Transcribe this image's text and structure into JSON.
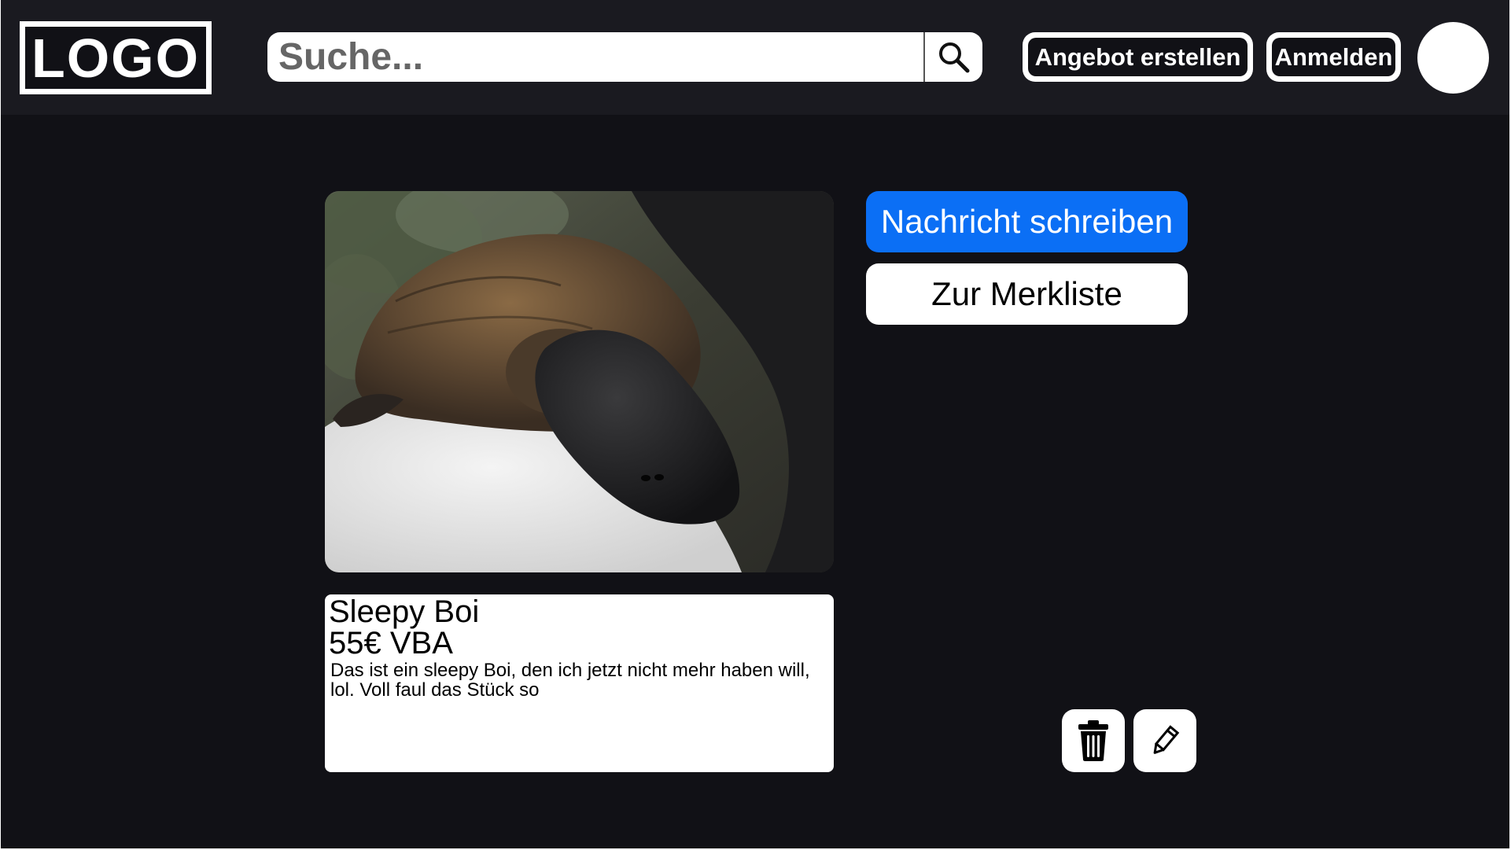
{
  "header": {
    "logo_text": "LOGO",
    "search_placeholder": "Suche...",
    "search_icon": "magnifier-icon",
    "create_offer_label": "Angebot erstellen",
    "login_label": "Anmelden"
  },
  "listing": {
    "image_description": "platypus-photo",
    "title": "Sleepy Boi",
    "price": "55€ VBA",
    "description": "Das ist ein sleepy Boi, den ich jetzt nicht mehr haben will, lol. Voll faul das Stück so"
  },
  "actions": {
    "message_label": "Nachricht schreiben",
    "watchlist_label": "Zur Merkliste",
    "delete_icon": "trash-icon",
    "edit_icon": "pencil-icon"
  },
  "colors": {
    "background": "#111116",
    "header": "#1a1a20",
    "accent": "#0b6ff5"
  }
}
